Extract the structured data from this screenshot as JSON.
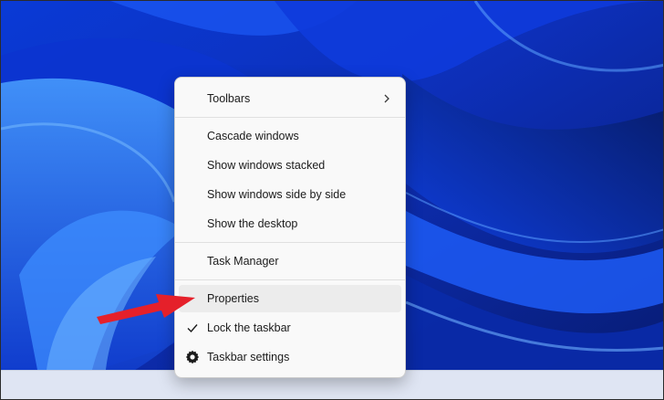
{
  "context_menu": {
    "items": [
      {
        "label": "Toolbars",
        "icon": "chevron-right-icon"
      },
      {
        "label": "Cascade windows"
      },
      {
        "label": "Show windows stacked"
      },
      {
        "label": "Show windows side by side"
      },
      {
        "label": "Show the desktop"
      },
      {
        "label": "Task Manager"
      },
      {
        "label": "Properties",
        "state": "hovered"
      },
      {
        "label": "Lock the taskbar",
        "icon": "check-icon",
        "checked": true
      },
      {
        "label": "Taskbar settings",
        "icon": "gear-icon"
      }
    ]
  },
  "colors": {
    "wallpaper_primary": "#0b2fbf",
    "menu_background": "#f9f9f9",
    "hover_background": "#ececec",
    "annotation_arrow": "#e5202a",
    "taskbar": "#dfe5f3"
  }
}
